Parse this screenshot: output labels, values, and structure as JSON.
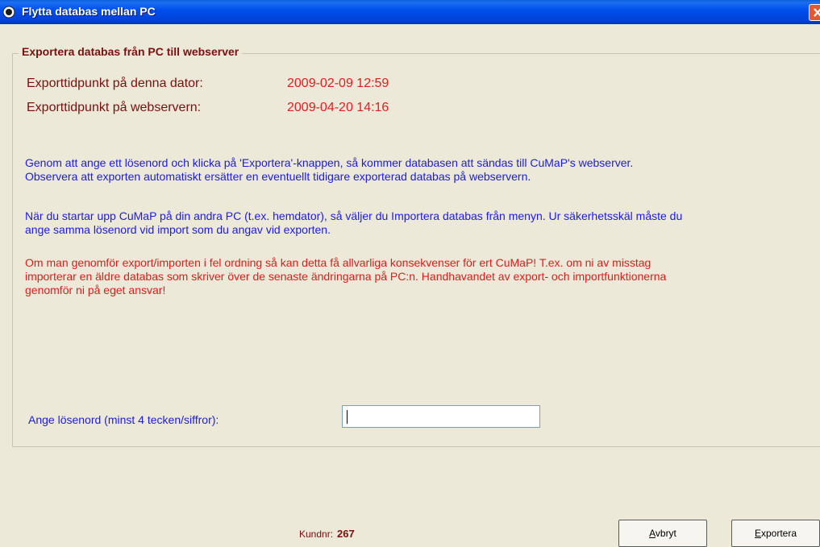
{
  "window": {
    "title": "Flytta databas mellan PC",
    "close_icon": "close-icon"
  },
  "group": {
    "title": "Exportera databas från PC till webserver"
  },
  "export_times": {
    "local_label": "Exporttidpunkt på denna dator:",
    "local_value": "2009-02-09 12:59",
    "server_label": "Exporttidpunkt på webservern:",
    "server_value": "2009-04-20 14:16"
  },
  "info": {
    "p1_line1": "Genom att ange ett lösenord och klicka på 'Exportera'-knappen, så kommer databasen att sändas till CuMaP's webserver.",
    "p1_line2": "Observera att exporten automatiskt ersätter en eventuellt tidigare exporterad databas på webservern.",
    "p2_line1": "När du startar upp CuMaP på din andra PC (t.ex. hemdator), så väljer du Importera databas från menyn. Ur säkerhetsskäl måste du",
    "p2_line2": "ange samma lösenord vid import som du angav vid exporten.",
    "warn_line1": "Om man genomför export/importen i fel ordning så kan detta få allvarliga konsekvenser för ert CuMaP! T.ex. om ni av misstag",
    "warn_line2": "importerar en äldre databas som skriver över de senaste ändringarna på PC:n. Handhavandet av export- och importfunktionerna",
    "warn_line3": "genomför ni på eget ansvar!"
  },
  "password": {
    "label": "Ange lösenord (minst 4 tecken/siffror):",
    "value": ""
  },
  "footer": {
    "kundnr_label": "Kundnr:",
    "kundnr_value": "267"
  },
  "buttons": {
    "cancel_accel": "A",
    "cancel_rest": "vbryt",
    "export_accel": "E",
    "export_rest": "xportera"
  },
  "colors": {
    "title_bar": "#0050ee",
    "heading": "#7a1010",
    "value_red": "#e02020",
    "info_blue": "#1c1ce0",
    "warning_red": "#e01c1c"
  }
}
